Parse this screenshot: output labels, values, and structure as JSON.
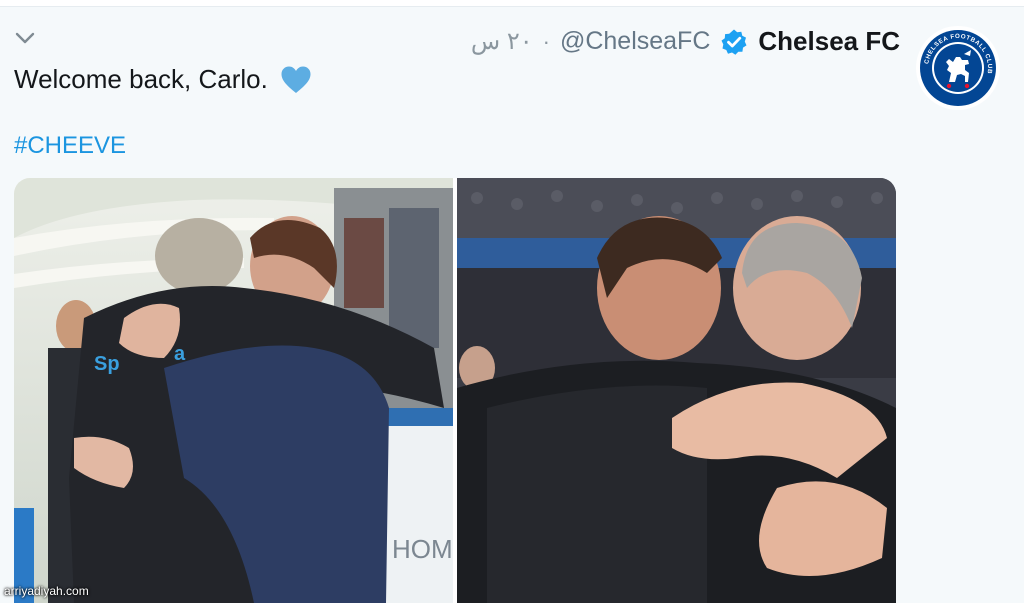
{
  "tweet": {
    "display_name": "Chelsea FC",
    "handle": "@ChelseaFC",
    "timestamp": "٢٠ س",
    "separator": "·",
    "text": "Welcome back, Carlo.",
    "hashtag": "#CHEEVE"
  },
  "icons": {
    "menu": "chevron-down-icon",
    "verified": "verified-badge-icon",
    "emoji": "blue-heart-icon",
    "avatar": "chelsea-crest-logo"
  },
  "avatar_logo_text": "CHELSEA FOOTBALL CLUB",
  "watermark": "arriyadiyah.com",
  "colors": {
    "link": "#1b95e0",
    "verified": "#1da1f2",
    "heart": "#5dade2",
    "crest_blue": "#034694"
  }
}
